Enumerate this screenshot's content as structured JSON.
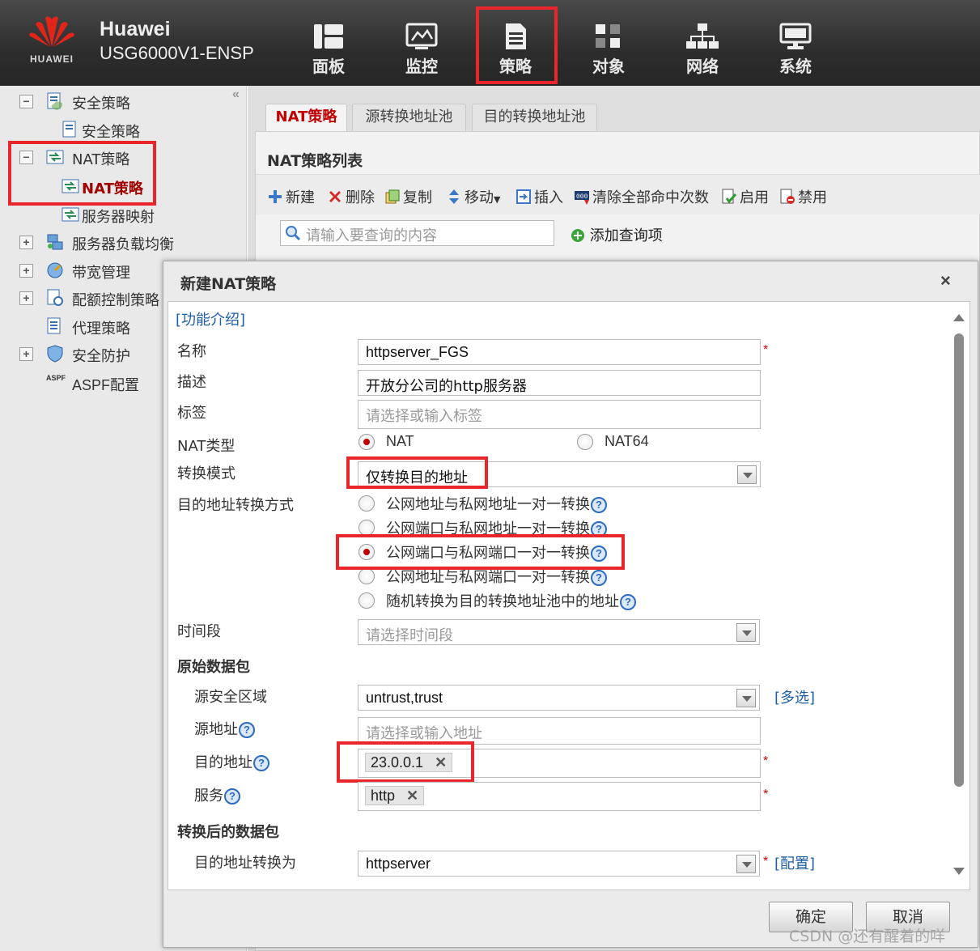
{
  "header": {
    "brand": "HUAWEI",
    "product_line1": "Huawei",
    "product_line2": "USG6000V1-ENSP",
    "nav": [
      {
        "label": "面板",
        "icon": "dashboard-icon"
      },
      {
        "label": "监控",
        "icon": "monitor-icon"
      },
      {
        "label": "策略",
        "icon": "policy-document-icon"
      },
      {
        "label": "对象",
        "icon": "object-icon"
      },
      {
        "label": "网络",
        "icon": "network-icon"
      },
      {
        "label": "系统",
        "icon": "system-computer-icon"
      }
    ]
  },
  "sidebar": {
    "items": [
      {
        "label": "安全策略",
        "expander": "−"
      },
      {
        "label": "安全策略"
      },
      {
        "label": "NAT策略",
        "expander": "−"
      },
      {
        "label": "NAT策略"
      },
      {
        "label": "服务器映射"
      },
      {
        "label": "服务器负载均衡",
        "expander": "+"
      },
      {
        "label": "带宽管理",
        "expander": "+"
      },
      {
        "label": "配额控制策略",
        "expander": "+"
      },
      {
        "label": "代理策略"
      },
      {
        "label": "安全防护",
        "expander": "+"
      },
      {
        "label": "ASPF配置",
        "icon_text": "ASPF"
      }
    ],
    "collapse": "«"
  },
  "tabs": [
    {
      "label": "NAT策略"
    },
    {
      "label": "源转换地址池"
    },
    {
      "label": "目的转换地址池"
    }
  ],
  "panel": {
    "title": "NAT策略列表",
    "toolbar": [
      "新建",
      "删除",
      "复制",
      "移动",
      "插入",
      "清除全部命中次数",
      "启用",
      "禁用"
    ],
    "search_placeholder": "请输入要查询的内容",
    "add_query": "添加查询项"
  },
  "dialog": {
    "title": "新建NAT策略",
    "close": "×",
    "intro_link": "[功能介绍]",
    "labels": {
      "name": "名称",
      "desc": "描述",
      "tag": "标签",
      "nat_type": "NAT类型",
      "mode": "转换模式",
      "dst_method": "目的地址转换方式",
      "time": "时间段",
      "orig_pkt": "原始数据包",
      "src_zone": "源安全区域",
      "src_addr": "源地址",
      "dst_addr": "目的地址",
      "service": "服务",
      "trans_pkt": "转换后的数据包",
      "dst_to": "目的地址转换为"
    },
    "values": {
      "name": "httpserver_FGS",
      "desc": "开放分公司的http服务器",
      "tag_placeholder": "请选择或输入标签",
      "mode": "仅转换目的地址",
      "time_placeholder": "请选择时间段",
      "src_zone": "untrust,trust",
      "src_addr_placeholder": "请选择或输入地址",
      "dst_addr_chip": "23.0.0.1",
      "service_chip": "http",
      "dst_to": "httpserver"
    },
    "nat_types": [
      {
        "label": "NAT",
        "checked": true
      },
      {
        "label": "NAT64",
        "checked": false
      }
    ],
    "methods": [
      {
        "label": "公网地址与私网地址一对一转换",
        "checked": false
      },
      {
        "label": "公网端口与私网地址一对一转换",
        "checked": false
      },
      {
        "label": "公网端口与私网端口一对一转换",
        "checked": true
      },
      {
        "label": "公网地址与私网端口一对一转换",
        "checked": false
      },
      {
        "label": "随机转换为目的转换地址池中的地址",
        "checked": false
      }
    ],
    "multi_select": "[多选]",
    "config": "[配置]",
    "required": "*",
    "help": "?",
    "chip_remove": "✕",
    "ok": "确定",
    "cancel": "取消"
  },
  "watermark": "CSDN @还有醒着的咩"
}
